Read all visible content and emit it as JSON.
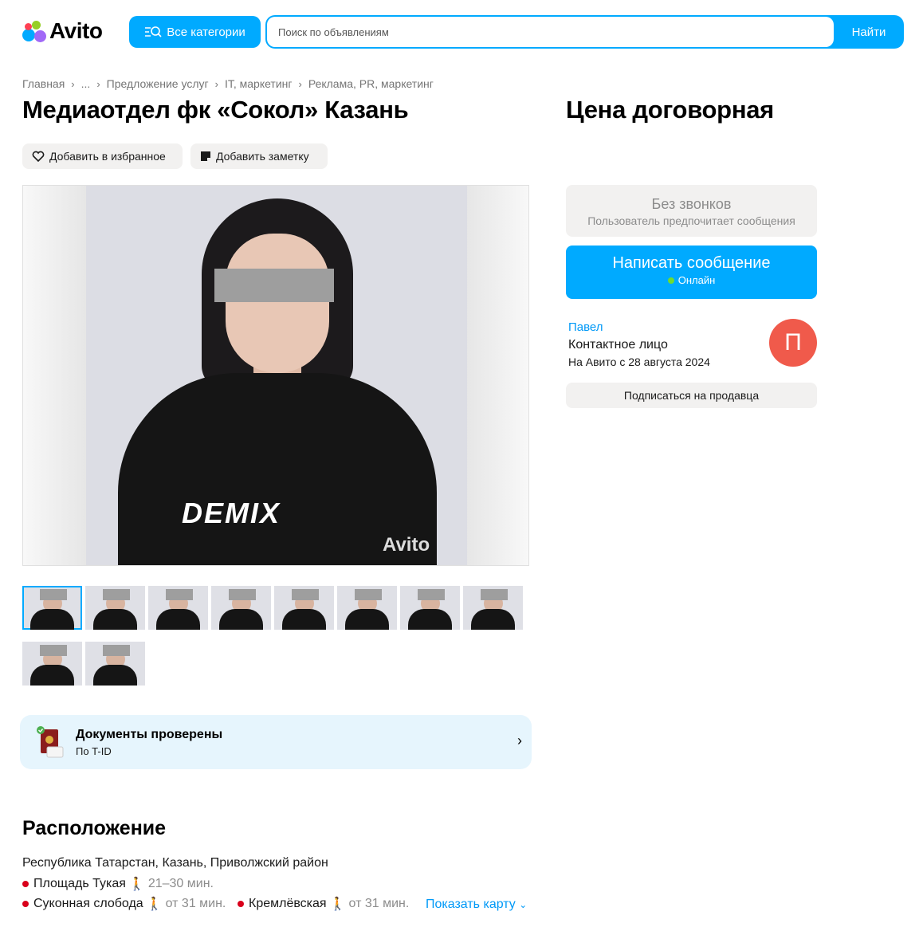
{
  "header": {
    "logo_text": "Avito",
    "categories_label": "Все категории",
    "search_placeholder": "Поиск по объявлениям",
    "search_button": "Найти",
    "colors": {
      "accent": "#00aaff"
    }
  },
  "breadcrumb": [
    "Главная",
    "...",
    "Предложение услуг",
    "IT, маркетинг",
    "Реклама, PR, маркетинг"
  ],
  "listing": {
    "title": "Медиаотдел фк «Сокол» Казань",
    "price": "Цена договорная",
    "favorite_label": "Добавить в избранное",
    "note_label": "Добавить заметку",
    "image_brand_text": "DEMIX",
    "watermark": "Avito",
    "thumbnail_count": 10
  },
  "docs": {
    "title": "Документы проверены",
    "subtitle": "По T-ID",
    "arrow": "›"
  },
  "location": {
    "title": "Расположение",
    "address": "Республика Татарстан, Казань, Приволжский район",
    "metro": [
      {
        "name": "Площадь Тукая",
        "time": "21–30 мин."
      },
      {
        "name": "Суконная слобода",
        "time": "от 31 мин."
      },
      {
        "name": "Кремлёвская",
        "time": "от 31 мин."
      }
    ],
    "show_map": "Показать карту"
  },
  "contact": {
    "no_calls_title": "Без звонков",
    "no_calls_sub": "Пользователь предпочитает сообщения",
    "write_label": "Написать сообщение",
    "online_label": "Онлайн",
    "seller_name": "Павел",
    "seller_role": "Контактное лицо",
    "seller_since": "На Авито с 28 августа 2024",
    "avatar_letter": "П",
    "subscribe_label": "Подписаться на продавца"
  }
}
